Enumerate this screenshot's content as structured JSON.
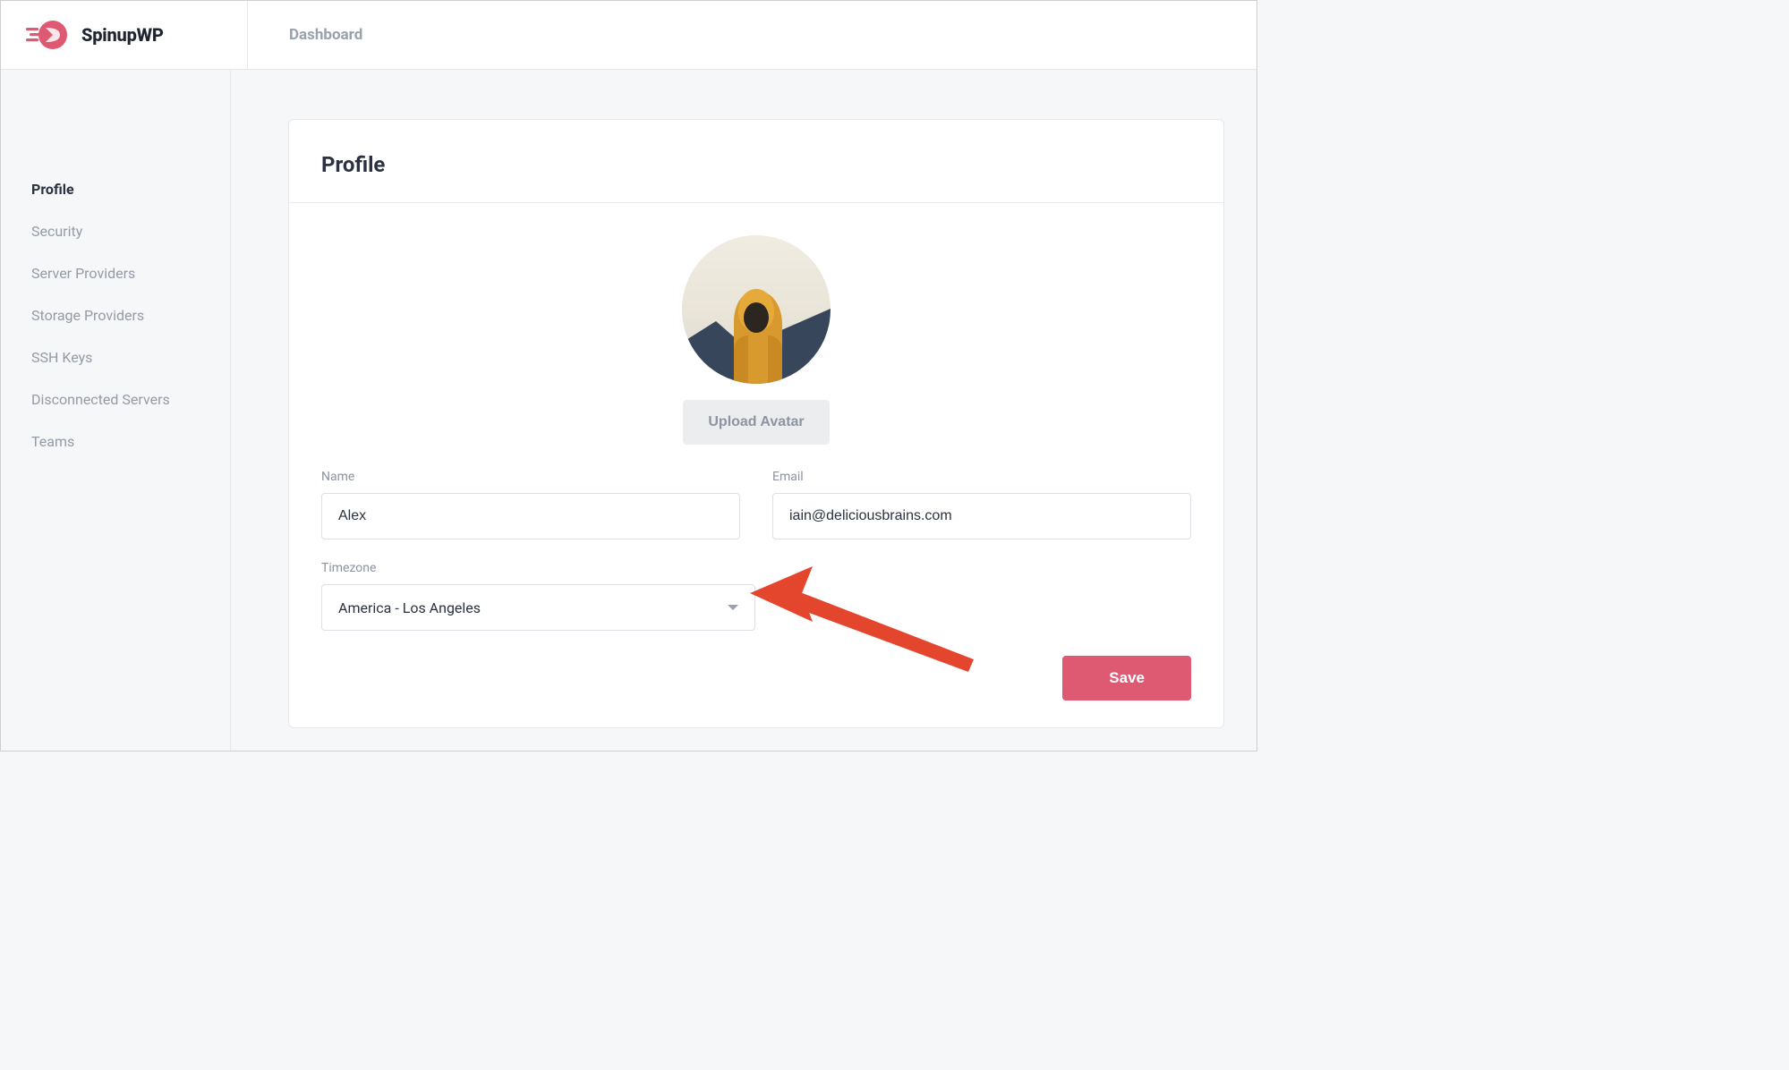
{
  "brand": {
    "name": "SpinupWP"
  },
  "breadcrumb": {
    "label": "Dashboard"
  },
  "sidebar": {
    "items": [
      {
        "label": "Profile",
        "active": true
      },
      {
        "label": "Security",
        "active": false
      },
      {
        "label": "Server Providers",
        "active": false
      },
      {
        "label": "Storage Providers",
        "active": false
      },
      {
        "label": "SSH Keys",
        "active": false
      },
      {
        "label": "Disconnected Servers",
        "active": false
      },
      {
        "label": "Teams",
        "active": false
      }
    ]
  },
  "page": {
    "title": "Profile",
    "upload_label": "Upload Avatar",
    "save_label": "Save"
  },
  "form": {
    "name": {
      "label": "Name",
      "value": "Alex"
    },
    "email": {
      "label": "Email",
      "value": "iain@deliciousbrains.com"
    },
    "timezone": {
      "label": "Timezone",
      "value": "America - Los Angeles"
    }
  },
  "colors": {
    "accent": "#de5a72"
  }
}
